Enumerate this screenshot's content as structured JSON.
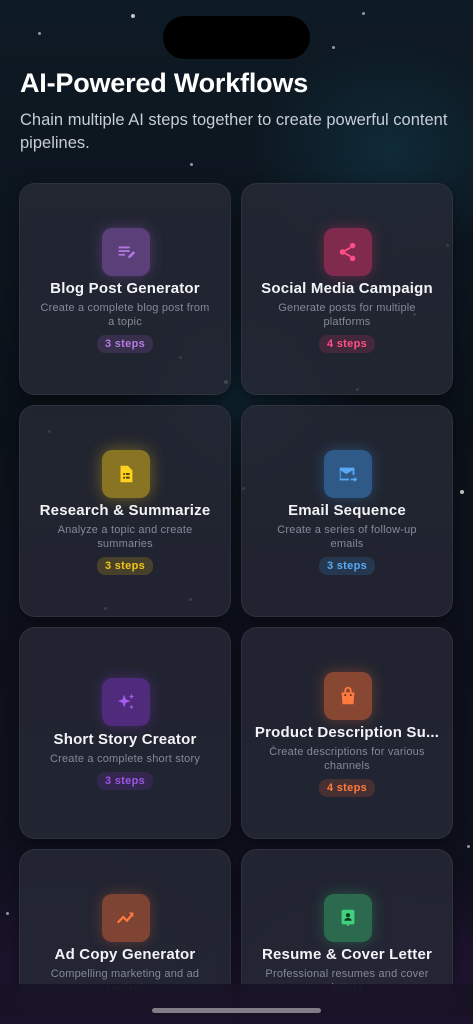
{
  "header": {
    "title": "AI-Powered Workflows",
    "subtitle": "Chain multiple AI steps together to create powerful content pipelines."
  },
  "workflows": [
    {
      "name": "Blog Post Generator",
      "description": "Create a complete blog post from a topic",
      "steps": "3 steps",
      "icon": "edit-note-icon",
      "color": "#a05fd0"
    },
    {
      "name": "Social Media Campaign",
      "description": "Generate posts for multiple platforms",
      "steps": "4 steps",
      "icon": "share-icon",
      "color": "#e0306a"
    },
    {
      "name": "Research & Summarize",
      "description": "Analyze a topic and create summaries",
      "steps": "3 steps",
      "icon": "document-icon",
      "color": "#f2c417"
    },
    {
      "name": "Email Sequence",
      "description": "Create a series of follow-up emails",
      "steps": "3 steps",
      "icon": "forward-email-icon",
      "color": "#3d8fe0"
    },
    {
      "name": "Short Story Creator",
      "description": "Create a complete short story",
      "steps": "3 steps",
      "icon": "sparkles-icon",
      "color": "#8a35d8"
    },
    {
      "name": "Product Description Su...",
      "description": "Create descriptions for various channels",
      "steps": "4 steps",
      "icon": "shopping-bag-icon",
      "color": "#f06a35"
    },
    {
      "name": "Ad Copy Generator",
      "description": "Compelling marketing and ad content",
      "steps": "",
      "icon": "trending-up-icon",
      "color": "#f06a35"
    },
    {
      "name": "Resume & Cover Letter",
      "description": "Professional resumes and cover letters",
      "steps": "",
      "icon": "id-badge-icon",
      "color": "#33b06a"
    }
  ]
}
